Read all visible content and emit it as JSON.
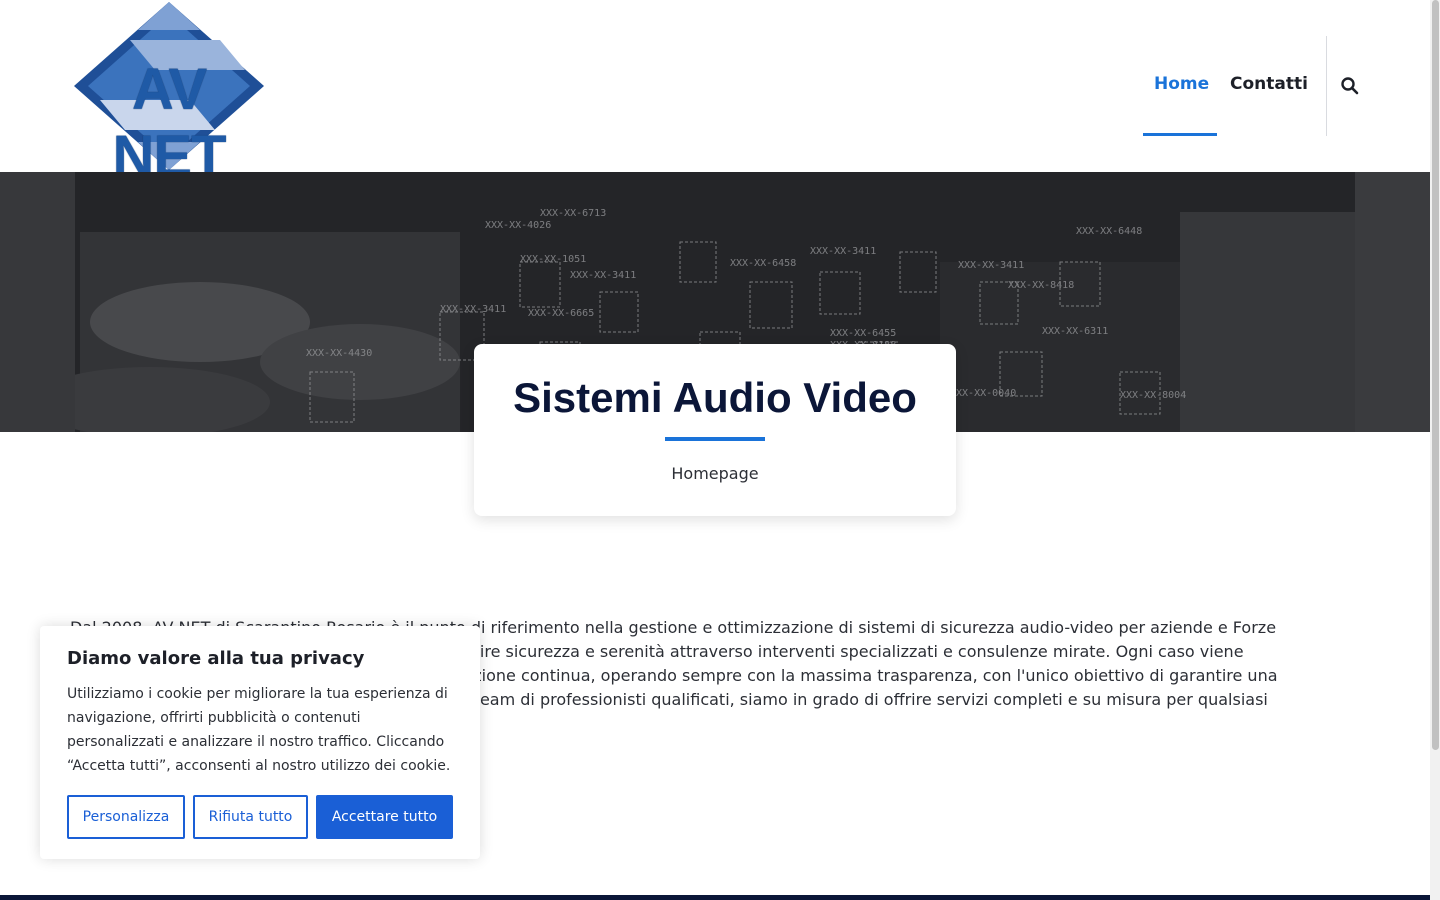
{
  "brand": {
    "logo_text": "AV NET"
  },
  "nav": {
    "items": [
      {
        "label": "Home",
        "active": true
      },
      {
        "label": "Contatti",
        "active": false
      }
    ],
    "search_icon": "search-icon"
  },
  "hero": {
    "title": "Sistemi Audio Video",
    "breadcrumb": "Homepage"
  },
  "intro": {
    "text": "Dal 2008, AV NET di Scarantino Rosario è il punto di riferimento nella gestione e ottimizzazione di sistemi di sicurezza audio-video per aziende e Forze dell'Ordine. Offriamo soluzioni avanzate per garantire sicurezza e serenità attraverso interventi specializzati e consulenze mirate. Ogni caso viene gestito combinando competenze tecniche e formazione continua, operando sempre con la massima trasparenza, con l'unico obiettivo di garantire una sicurezza totale. Grazie a competenze solide e un team di professionisti qualificati, siamo in grado di offrire servizi completi e su misura per qualsiasi esigenza in ambito audio e video."
  },
  "cookie_banner": {
    "title": "Diamo valore alla tua privacy",
    "text": "Utilizziamo i cookie per migliorare la tua esperienza di navigazione, offrirti pubblicità o contenuti personalizzati e analizzare il nostro traffico. Cliccando “Accetta tutti”, acconsenti al nostro utilizzo dei cookie.",
    "buttons": {
      "customize": "Personalizza",
      "reject": "Rifiuta tutto",
      "accept": "Accettare tutto"
    }
  },
  "colors": {
    "accent": "#1a73d9",
    "button": "#1a5fd6",
    "title": "#0b1638"
  }
}
